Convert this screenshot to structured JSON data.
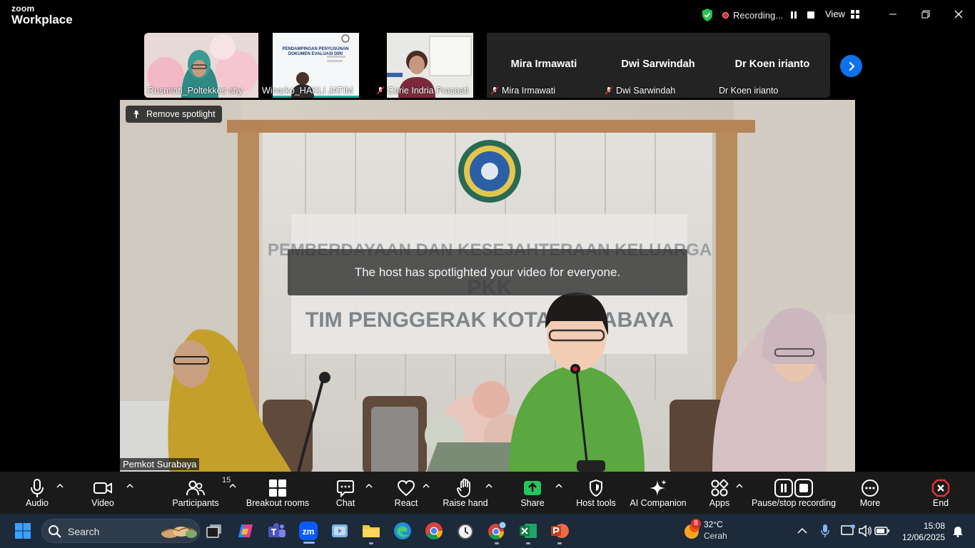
{
  "app": {
    "logo_line1": "zoom",
    "logo_line2": "Workplace",
    "recording_label": "Recording...",
    "view_label": "View"
  },
  "participants_strip": [
    {
      "name": "Rusmiati_Poltekkes sby",
      "muted": false
    },
    {
      "name": "Winarko_HAKLI JATIM",
      "muted": false
    },
    {
      "name": "Corie Indria Prasasti",
      "muted": true
    },
    {
      "name": "Mira Irmawati",
      "display_name": "Mira Irmawati",
      "muted": true
    },
    {
      "name": "Dwi Sarwindah",
      "display_name": "Dwi Sarwindah",
      "muted": true
    },
    {
      "name": "Dr  Koen irianto",
      "display_name": "Dr  Koen irianto",
      "muted": false
    }
  ],
  "main_video": {
    "remove_spotlight_label": "Remove spotlight",
    "toast": "The host has spotlighted your video for everyone.",
    "participant_name": "Pemkot Surabaya",
    "backdrop_line1": "PEMBERDAYAAN DAN KESEJAHTERAAN KELUARGA",
    "backdrop_line2": "PKK",
    "backdrop_line3": "TIM PENGGERAK KOTA SURABAYA"
  },
  "slide_thumb": {
    "title_line1": "PENDAMPINGAN PENYUSUNAN",
    "title_line2": "DOKUMEN EVALUASI DIRI"
  },
  "toolbar": {
    "audio": "Audio",
    "video": "Video",
    "participants": "Participants",
    "participants_count": "15",
    "breakout": "Breakout rooms",
    "chat": "Chat",
    "react": "React",
    "raise_hand": "Raise hand",
    "share": "Share",
    "host_tools": "Host tools",
    "ai_companion": "AI Companion",
    "apps": "Apps",
    "pause_recording": "Pause/stop recording",
    "more": "More",
    "end": "End"
  },
  "taskbar": {
    "search_placeholder": "Search",
    "weather_badge": "8",
    "temperature": "32°C",
    "condition": "Cerah",
    "time": "15:08",
    "date": "12/06/2025"
  },
  "colors": {
    "accent": "#0e72ed",
    "share_green": "#22c55e",
    "end_red": "#e5303b",
    "toolbar_bg": "#1a1a1a"
  }
}
